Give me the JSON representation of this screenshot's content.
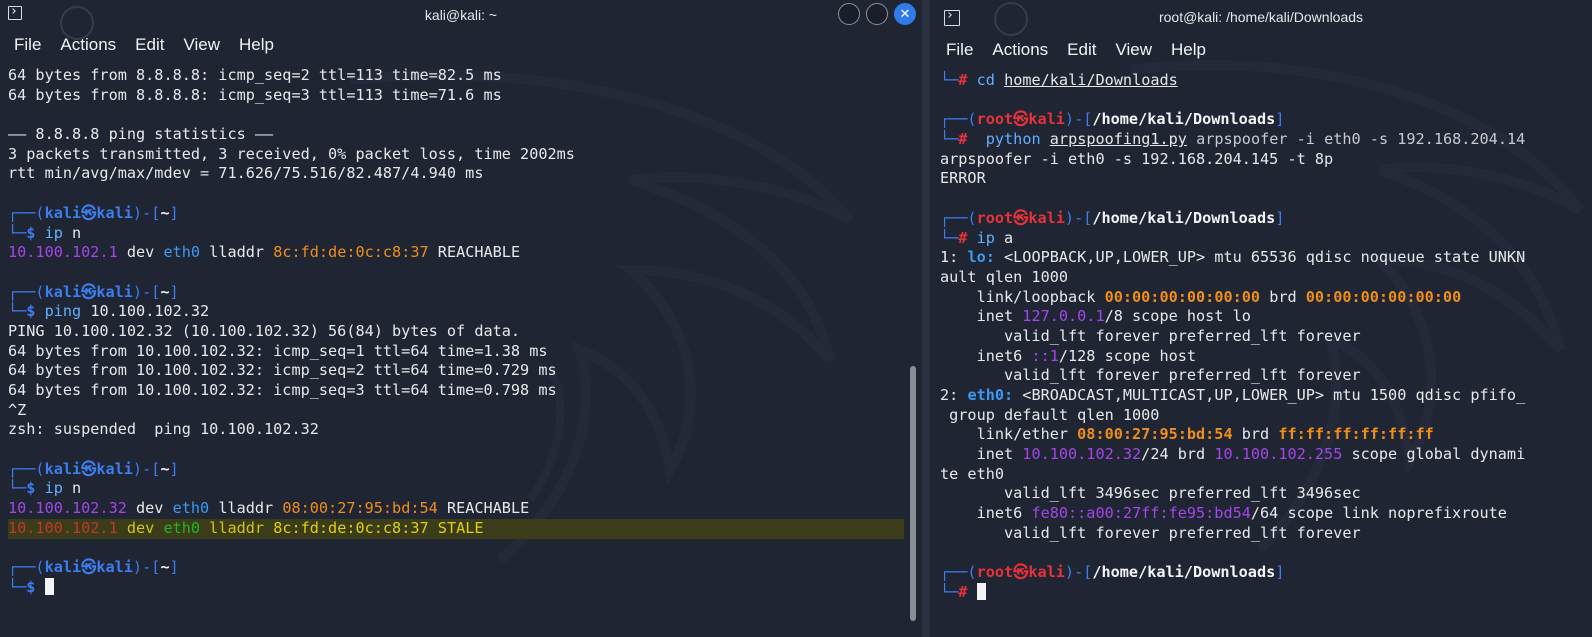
{
  "left": {
    "title": "kali@kali: ~",
    "menu": [
      "File",
      "Actions",
      "Edit",
      "View",
      "Help"
    ],
    "lines": [
      {
        "kind": "text",
        "text": "64 bytes from 8.8.8.8: icmp_seq=2 ttl=113 time=82.5 ms"
      },
      {
        "kind": "text",
        "text": "64 bytes from 8.8.8.8: icmp_seq=3 ttl=113 time=71.6 ms"
      },
      {
        "kind": "blank"
      },
      {
        "kind": "text",
        "text": "—— 8.8.8.8 ping statistics ——"
      },
      {
        "kind": "text",
        "text": "3 packets transmitted, 3 received, 0% packet loss, time 2002ms"
      },
      {
        "kind": "text",
        "text": "rtt min/avg/max/mdev = 71.626/75.516/82.487/4.940 ms"
      },
      {
        "kind": "blank"
      },
      {
        "kind": "prompt1",
        "user": "kali",
        "host": "kali",
        "dir": "~"
      },
      {
        "kind": "prompt2",
        "sym": "$",
        "cmd": "ip",
        "args": " n"
      },
      {
        "kind": "neigh",
        "ip": "10.100.102.1",
        "dev": "eth0",
        "mac": "8c:fd:de:0c:c8:37",
        "state": "REACHABLE"
      },
      {
        "kind": "blank"
      },
      {
        "kind": "prompt1",
        "user": "kali",
        "host": "kali",
        "dir": "~"
      },
      {
        "kind": "prompt2",
        "sym": "$",
        "cmd": "ping",
        "args": " 10.100.102.32"
      },
      {
        "kind": "text",
        "text": "PING 10.100.102.32 (10.100.102.32) 56(84) bytes of data."
      },
      {
        "kind": "text",
        "text": "64 bytes from 10.100.102.32: icmp_seq=1 ttl=64 time=1.38 ms"
      },
      {
        "kind": "text",
        "text": "64 bytes from 10.100.102.32: icmp_seq=2 ttl=64 time=0.729 ms"
      },
      {
        "kind": "text",
        "text": "64 bytes from 10.100.102.32: icmp_seq=3 ttl=64 time=0.798 ms"
      },
      {
        "kind": "text",
        "text": "^Z"
      },
      {
        "kind": "text",
        "text": "zsh: suspended  ping 10.100.102.32"
      },
      {
        "kind": "blank"
      },
      {
        "kind": "prompt1",
        "user": "kali",
        "host": "kali",
        "dir": "~"
      },
      {
        "kind": "prompt2",
        "sym": "$",
        "cmd": "ip",
        "args": " n"
      },
      {
        "kind": "neigh",
        "ip": "10.100.102.32",
        "dev": "eth0",
        "mac": "08:00:27:95:bd:54",
        "state": "REACHABLE"
      },
      {
        "kind": "neigh-stale",
        "ip": "10.100.102.1",
        "dev": "eth0",
        "mac": "8c:fd:de:0c:c8:37",
        "state": "STALE"
      },
      {
        "kind": "blank"
      },
      {
        "kind": "prompt1",
        "user": "kali",
        "host": "kali",
        "dir": "~"
      },
      {
        "kind": "prompt2-cursor",
        "sym": "$"
      }
    ]
  },
  "right": {
    "title": "root@kali: /home/kali/Downloads",
    "menu": [
      "File",
      "Actions",
      "Edit",
      "View",
      "Help"
    ],
    "lines": [
      {
        "kind": "rprompt2",
        "sym": "#",
        "cmd": "cd",
        "args": " ",
        "ularg": "home/kali/Downloads",
        "rest": ""
      },
      {
        "kind": "blank"
      },
      {
        "kind": "rprompt1",
        "user": "root",
        "host": "kali",
        "dir": "/home/kali/Downloads"
      },
      {
        "kind": "rprompt2",
        "sym": "#",
        "cmd": " python",
        "args": " ",
        "ularg": "arpspoofing1.py",
        "rest": " arpspoofer -i eth0 -s 192.168.204.14"
      },
      {
        "kind": "text",
        "text": "arpspoofer -i eth0 -s 192.168.204.145 -t 8p"
      },
      {
        "kind": "text",
        "text": "ERROR"
      },
      {
        "kind": "blank"
      },
      {
        "kind": "rprompt1",
        "user": "root",
        "host": "kali",
        "dir": "/home/kali/Downloads"
      },
      {
        "kind": "rprompt2",
        "sym": "#",
        "cmd": "ip",
        "args": " a",
        "ularg": "",
        "rest": ""
      },
      {
        "kind": "iface",
        "num": "1:",
        "name": "lo:",
        "rest": " <LOOPBACK,UP,LOWER_UP> mtu 65536 qdisc noqueue state UNKN"
      },
      {
        "kind": "text",
        "text": "ault qlen 1000"
      },
      {
        "kind": "hw",
        "pre": "    link/loopback ",
        "a": "00:00:00:00:00:00",
        "mid": " brd ",
        "b": "00:00:00:00:00:00",
        "post": ""
      },
      {
        "kind": "addr",
        "pre": "    inet ",
        "a": "127.0.0.1",
        "mid": "/8 scope host lo",
        "b": "",
        "post": ""
      },
      {
        "kind": "text",
        "text": "       valid_lft forever preferred_lft forever"
      },
      {
        "kind": "addr",
        "pre": "    inet6 ",
        "a": "::1",
        "mid": "/128 scope host",
        "b": "",
        "post": ""
      },
      {
        "kind": "text",
        "text": "       valid_lft forever preferred_lft forever"
      },
      {
        "kind": "iface",
        "num": "2:",
        "name": "eth0:",
        "rest": " <BROADCAST,MULTICAST,UP,LOWER_UP> mtu 1500 qdisc pfifo_"
      },
      {
        "kind": "text",
        "text": " group default qlen 1000"
      },
      {
        "kind": "hw",
        "pre": "    link/ether ",
        "a": "08:00:27:95:bd:54",
        "mid": " brd ",
        "b": "ff:ff:ff:ff:ff:ff",
        "post": ""
      },
      {
        "kind": "addr",
        "pre": "    inet ",
        "a": "10.100.102.32",
        "mid": "/24 brd ",
        "b": "10.100.102.255",
        "post": " scope global dynami"
      },
      {
        "kind": "text",
        "text": "te eth0"
      },
      {
        "kind": "text",
        "text": "       valid_lft 3496sec preferred_lft 3496sec"
      },
      {
        "kind": "addr",
        "pre": "    inet6 ",
        "a": "fe80::a00:27ff:fe95:bd54",
        "mid": "/64 scope link noprefixroute",
        "b": "",
        "post": ""
      },
      {
        "kind": "text",
        "text": "       valid_lft forever preferred_lft forever"
      },
      {
        "kind": "blank"
      },
      {
        "kind": "rprompt1",
        "user": "root",
        "host": "kali",
        "dir": "/home/kali/Downloads"
      },
      {
        "kind": "rprompt2-cursor",
        "sym": "#"
      }
    ]
  },
  "colors": {
    "prompt_blue": "#3d7df0",
    "prompt_red": "#e8323a",
    "ip_purple": "#a347e8",
    "mac_orange": "#f08e1a",
    "close_button": "#2f7ce8"
  },
  "icons": [
    "terminal-icon",
    "minimize-icon",
    "maximize-icon",
    "close-icon",
    "kali-dragon-watermark"
  ]
}
